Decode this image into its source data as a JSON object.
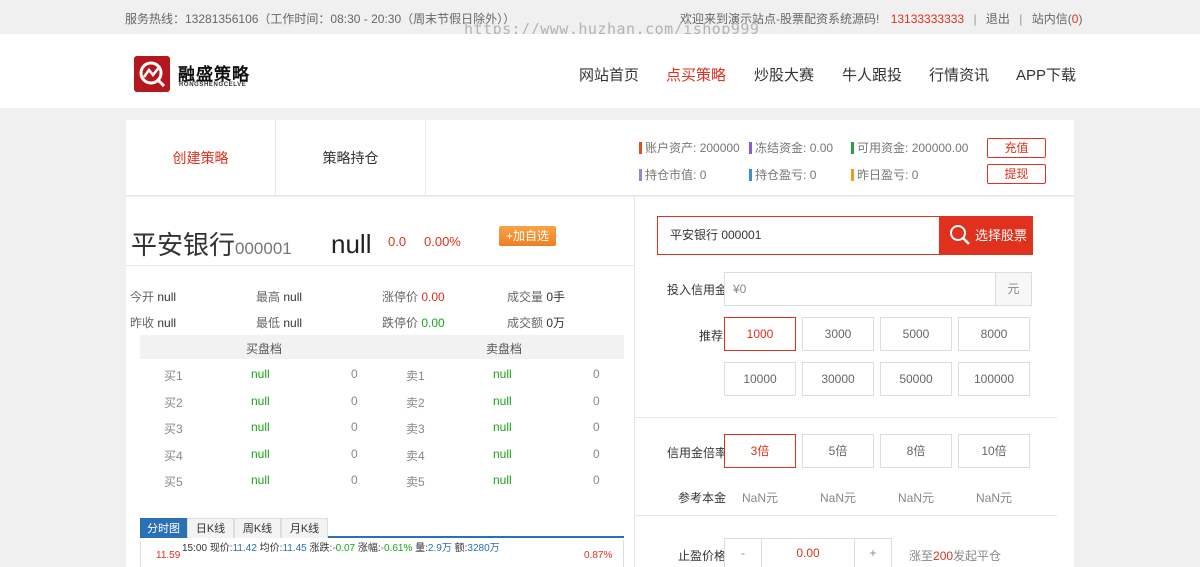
{
  "topbar": {
    "hotline": "服务热线：13281356106（工作时间：08:30 - 20:30（周末节假日除外））",
    "welcome": "欢迎来到演示站点-股票配资系统源码!",
    "phone": "13133333333",
    "logout": "退出",
    "messages_label": "站内信",
    "messages_count": "0"
  },
  "watermark": "https://www.huzhan.com/ishop999",
  "header": {
    "logo_cn": "融盛策略",
    "logo_en": "RONGSHENGCELVE",
    "nav": [
      "网站首页",
      "点买策略",
      "炒股大赛",
      "牛人跟投",
      "行情资讯",
      "APP下载"
    ]
  },
  "tabs": {
    "create": "创建策略",
    "hold": "策略持仓"
  },
  "account": {
    "assets_label": "账户资产:",
    "assets": "200000",
    "frozen_label": "冻结资金:",
    "frozen": "0.00",
    "available_label": "可用资金:",
    "available": "200000.00",
    "market_label": "持仓市值:",
    "market": "0",
    "profit_label": "持仓盈亏:",
    "profit": "0",
    "yesterday_label": "昨日盈亏:",
    "yesterday": "0",
    "recharge": "充值",
    "withdraw": "提现",
    "colors": {
      "assets": "#e0501e",
      "frozen": "#8a5cd0",
      "available": "#2f9e3a",
      "market": "#8a8ad8",
      "profit": "#3a8fd8",
      "yesterday": "#e8a020"
    }
  },
  "stock": {
    "name": "平安银行",
    "code": "000001",
    "price": "null",
    "change": "0.0",
    "change_pct": "0.00%",
    "add_fav": "+加自选"
  },
  "quote": {
    "open_label": "今开",
    "open": "null",
    "high_label": "最高",
    "high": "null",
    "limit_up_label": "涨停价",
    "limit_up": "0.00",
    "volume_label": "成交量",
    "volume": "0手",
    "prev_label": "昨收",
    "prev": "null",
    "low_label": "最低",
    "low": "null",
    "limit_down_label": "跌停价",
    "limit_down": "0.00",
    "amount_label": "成交额",
    "amount": "0万"
  },
  "orderbook": {
    "buy_title": "买盘档",
    "sell_title": "卖盘档",
    "buy": [
      {
        "label": "买1",
        "price": "null",
        "vol": "0"
      },
      {
        "label": "买2",
        "price": "null",
        "vol": "0"
      },
      {
        "label": "买3",
        "price": "null",
        "vol": "0"
      },
      {
        "label": "买4",
        "price": "null",
        "vol": "0"
      },
      {
        "label": "买5",
        "price": "null",
        "vol": "0"
      }
    ],
    "sell": [
      {
        "label": "卖1",
        "price": "null",
        "vol": "0"
      },
      {
        "label": "卖2",
        "price": "null",
        "vol": "0"
      },
      {
        "label": "卖3",
        "price": "null",
        "vol": "0"
      },
      {
        "label": "卖4",
        "price": "null",
        "vol": "0"
      },
      {
        "label": "卖5",
        "price": "null",
        "vol": "0"
      }
    ]
  },
  "chart_tabs": [
    "分时图",
    "日K线",
    "周K线",
    "月K线"
  ],
  "kinfo": {
    "time": "15:00",
    "now_label": "现价:",
    "now": "11.42",
    "avg_label": "均价:",
    "avg": "11.45",
    "chg_label": "涨跌:",
    "chg": "-0.07",
    "pct_label": "涨幅:",
    "pct": "-0.61%",
    "vol_label": "量:",
    "vol": "2.9万",
    "amt_label": "额:",
    "amt": "3280万",
    "axis_left": "11.59",
    "axis_right": "0.87%"
  },
  "form": {
    "search_value": "平安银行   000001",
    "search_button": "选择股票",
    "credit_label": "投入信用金",
    "credit_placeholder": "¥0",
    "credit_unit": "元",
    "recommend_label": "推荐",
    "recommend": [
      "1000",
      "3000",
      "5000",
      "8000",
      "10000",
      "30000",
      "50000",
      "100000"
    ],
    "multiplier_label": "信用金倍率",
    "multipliers": [
      "3倍",
      "5倍",
      "8倍",
      "10倍"
    ],
    "principal_label": "参考本金",
    "principal": [
      "NaN元",
      "NaN元",
      "NaN元",
      "NaN元"
    ],
    "stop_label": "止盈价格",
    "stop_minus": "-",
    "stop_value": "0.00",
    "stop_plus": "+",
    "stop_hint_pre": "涨至",
    "stop_hint_num": "200",
    "stop_hint_post": "发起平仓"
  }
}
